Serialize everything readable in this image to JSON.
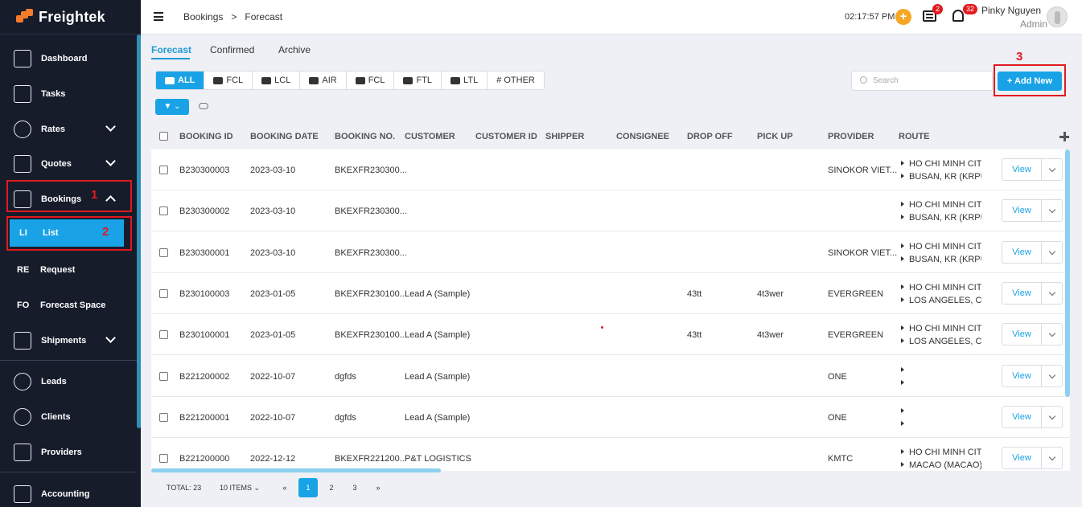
{
  "app": {
    "name": "Freightek"
  },
  "sidebar": {
    "items": [
      {
        "label": "Dashboard",
        "icon": "dashboard-icon"
      },
      {
        "label": "Tasks",
        "icon": "tasks-icon"
      },
      {
        "label": "Rates",
        "icon": "rates-icon"
      },
      {
        "label": "Quotes",
        "icon": "quotes-icon"
      },
      {
        "label": "Bookings",
        "icon": "bookings-icon"
      },
      {
        "label": "List",
        "abbr": "LI"
      },
      {
        "label": "Request",
        "abbr": "RE"
      },
      {
        "label": "Forecast Space",
        "abbr": "FO"
      },
      {
        "label": "Shipments",
        "icon": "shipments-icon"
      },
      {
        "label": "Leads",
        "icon": "leads-icon"
      },
      {
        "label": "Clients",
        "icon": "clients-icon"
      },
      {
        "label": "Providers",
        "icon": "providers-icon"
      },
      {
        "label": "Accounting",
        "icon": "accounting-icon"
      }
    ]
  },
  "annotations": [
    "1",
    "2",
    "3"
  ],
  "topbar": {
    "breadcrumb": [
      "Bookings",
      ">",
      "Forecast"
    ],
    "time": "02:17:57 PM",
    "plus": "+",
    "chat_badge": "2",
    "notif_badge": "32",
    "user_name": "Pinky Nguyen",
    "user_role": "Admin"
  },
  "tabs": [
    "Forecast",
    "Confirmed",
    "Archive"
  ],
  "types": [
    "ALL",
    "FCL",
    "LCL",
    "AIR",
    "FCL",
    "FTL",
    "LTL",
    "# OTHER"
  ],
  "search": {
    "placeholder": "Search"
  },
  "add_new": "+ Add New",
  "filter_label": "▼ ⌄",
  "columns": [
    "BOOKING ID",
    "BOOKING DATE",
    "BOOKING NO.",
    "CUSTOMER",
    "CUSTOMER ID",
    "SHIPPER",
    "CONSIGNEE",
    "DROP OFF",
    "PICK UP",
    "PROVIDER",
    "ROUTE"
  ],
  "rows": [
    {
      "id": "B230300003",
      "date": "2023-03-10",
      "no": "BKEXFR230300...",
      "customer": "",
      "drop": "",
      "pick": "",
      "provider": "SINOKOR VIET...",
      "route_from": "HO CHI MINH CITY, ",
      "route_to": "BUSAN, KR (KRPUS)"
    },
    {
      "id": "B230300002",
      "date": "2023-03-10",
      "no": "BKEXFR230300...",
      "customer": "",
      "drop": "",
      "pick": "",
      "provider": "",
      "route_from": "HO CHI MINH CITY, ",
      "route_to": "BUSAN, KR (KRPUS)"
    },
    {
      "id": "B230300001",
      "date": "2023-03-10",
      "no": "BKEXFR230300...",
      "customer": "",
      "drop": "",
      "pick": "",
      "provider": "SINOKOR VIET...",
      "route_from": "HO CHI MINH CITY, ",
      "route_to": "BUSAN, KR (KRPUS)"
    },
    {
      "id": "B230100003",
      "date": "2023-01-05",
      "no": "BKEXFR230100...",
      "customer": "Lead A (Sample)",
      "drop": "43tt",
      "pick": "4t3wer",
      "provider": "EVERGREEN",
      "route_from": "HO CHI MINH CITY, ",
      "route_to": "LOS ANGELES, CA, U"
    },
    {
      "id": "B230100001",
      "date": "2023-01-05",
      "no": "BKEXFR230100...",
      "customer": "Lead A (Sample)",
      "drop": "43tt",
      "pick": "4t3wer",
      "provider": "EVERGREEN",
      "route_from": "HO CHI MINH CITY, ",
      "route_to": "LOS ANGELES, CA, U"
    },
    {
      "id": "B221200002",
      "date": "2022-10-07",
      "no": "dgfds",
      "customer": "Lead A (Sample)",
      "drop": "",
      "pick": "",
      "provider": "ONE",
      "route_from": "",
      "route_to": ""
    },
    {
      "id": "B221200001",
      "date": "2022-10-07",
      "no": "dgfds",
      "customer": "Lead A (Sample)",
      "drop": "",
      "pick": "",
      "provider": "ONE",
      "route_from": "",
      "route_to": ""
    },
    {
      "id": "B221200000",
      "date": "2022-12-12",
      "no": "BKEXFR221200...",
      "customer": "P&T LOGISTICS",
      "drop": "",
      "pick": "",
      "provider": "KMTC",
      "route_from": "HO CHI MINH CITY, ",
      "route_to": "MACAO (MACAO), C"
    }
  ],
  "view_label": "View",
  "footer": {
    "total": "TOTAL: 23",
    "per_page": "10 ITEMS ⌄",
    "prev": "«",
    "next": "»",
    "pages": [
      "1",
      "2",
      "3"
    ]
  },
  "colors": {
    "accent": "#19a3e6",
    "sidebar": "#171c2b",
    "highlight": "#e2191e",
    "brand": "#f47c2a"
  }
}
